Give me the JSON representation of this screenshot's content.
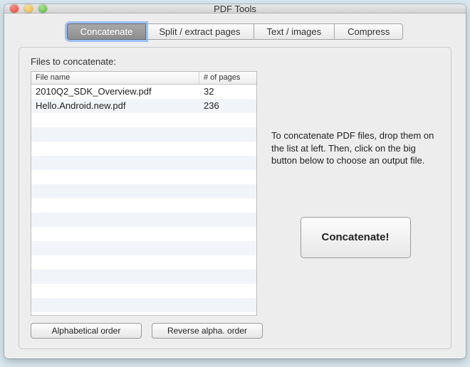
{
  "window": {
    "title": "PDF Tools"
  },
  "tabs": [
    {
      "label": "Concatenate",
      "active": true
    },
    {
      "label": "Split / extract pages",
      "active": false
    },
    {
      "label": "Text / images",
      "active": false
    },
    {
      "label": "Compress",
      "active": false
    }
  ],
  "panel": {
    "label": "Files to concatenate:",
    "columns": {
      "name": "File name",
      "pages": "# of pages"
    },
    "rows": [
      {
        "name": "2010Q2_SDK_Overview.pdf",
        "pages": "32"
      },
      {
        "name": "Hello.Android.new.pdf",
        "pages": "236"
      }
    ],
    "instructions": "To concatenate PDF files, drop them on the list at left. Then, click on the big button below to choose an output file.",
    "concatenate_button": "Concatenate!",
    "alpha_button": "Alphabetical order",
    "reverse_button": "Reverse alpha. order"
  }
}
